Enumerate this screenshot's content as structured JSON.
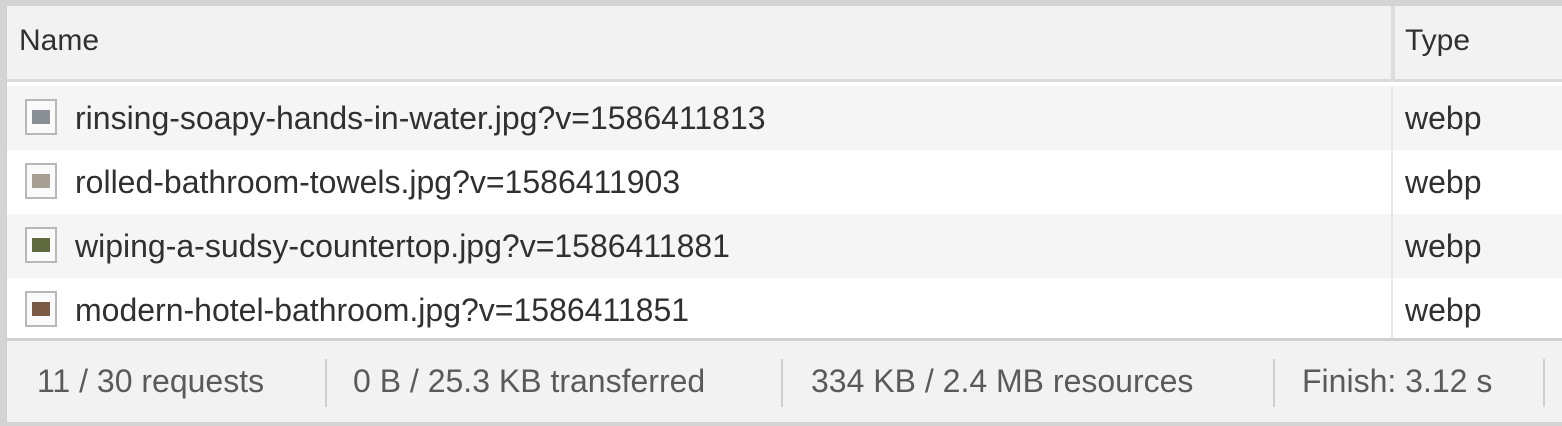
{
  "table": {
    "columns": {
      "name": "Name",
      "type": "Type"
    },
    "rows": [
      {
        "name": "rinsing-soapy-hands-in-water.jpg?v=1586411813",
        "type": "webp",
        "thumb_color": "#8a8f95"
      },
      {
        "name": "rolled-bathroom-towels.jpg?v=1586411903",
        "type": "webp",
        "thumb_color": "#a79f92"
      },
      {
        "name": "wiping-a-sudsy-countertop.jpg?v=1586411881",
        "type": "webp",
        "thumb_color": "#5f6a3f"
      },
      {
        "name": "modern-hotel-bathroom.jpg?v=1586411851",
        "type": "webp",
        "thumb_color": "#7a5a45"
      }
    ]
  },
  "footer": {
    "requests": "11 / 30 requests",
    "transferred": "0 B / 25.3 KB transferred",
    "resources": "334 KB / 2.4 MB resources",
    "finish": "Finish: 3.12 s"
  }
}
